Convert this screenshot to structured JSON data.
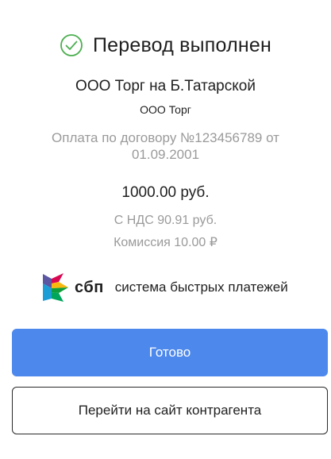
{
  "header": {
    "title": "Перевод выполнен",
    "icon": "check-circle-icon",
    "icon_color": "#4caf50"
  },
  "payment": {
    "merchant": "ООО Торг на Б.Татарской",
    "merchant_short": "ООО Торг",
    "purpose": "Оплата по договору №123456789 от 01.09.2001",
    "amount": "1000.00 руб.",
    "vat": "С НДС 90.91 руб.",
    "fee": "Комиссия 10.00 ₽"
  },
  "sbp": {
    "short": "сбп",
    "full": "система быстрых платежей",
    "icon": "sbp-logo-icon"
  },
  "buttons": {
    "done_label": "Готово",
    "goto_label": "Перейти на сайт контрагента",
    "primary_color": "#4d88ec"
  }
}
